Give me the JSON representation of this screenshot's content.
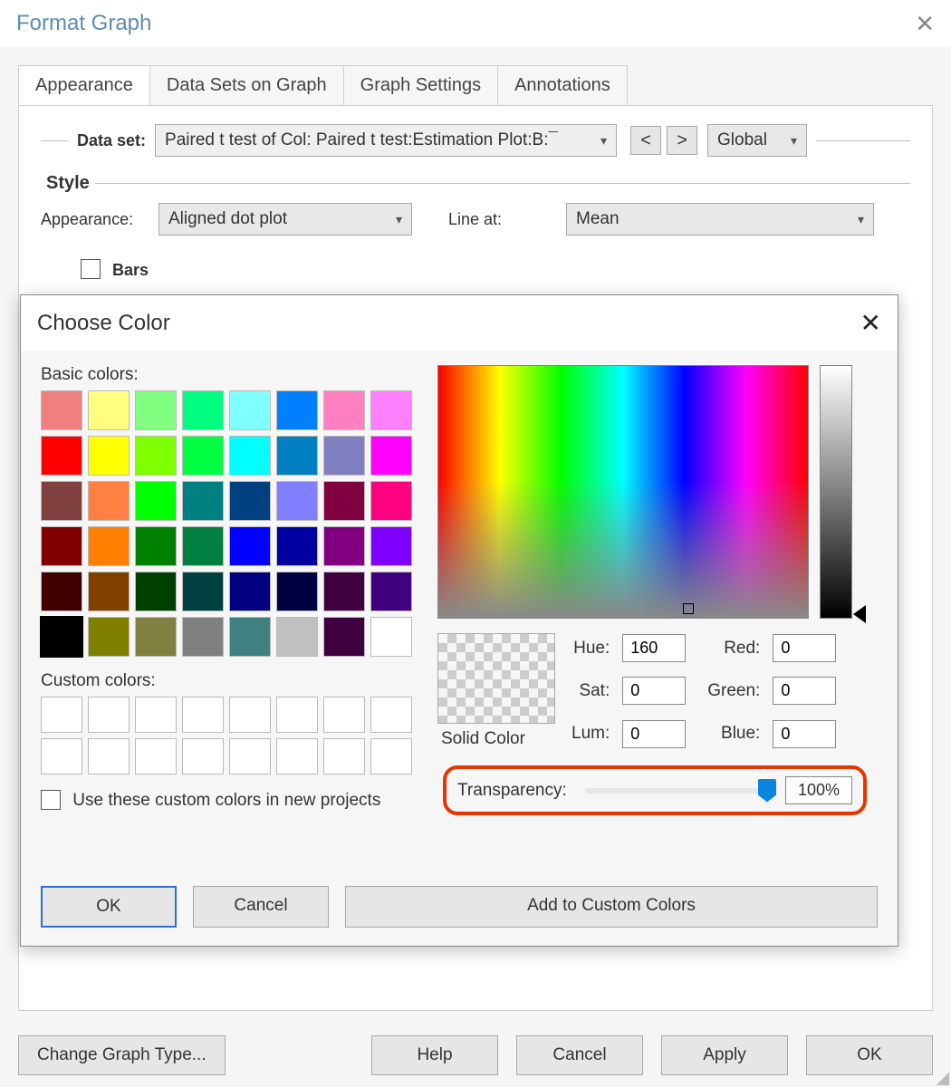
{
  "window": {
    "title": "Format Graph"
  },
  "tabs": {
    "appearance": "Appearance",
    "datasets": "Data Sets on Graph",
    "graph_settings": "Graph Settings",
    "annotations": "Annotations"
  },
  "dataset": {
    "label": "Data set:",
    "value": "Paired t test of Col: Paired t test:Estimation Plot:B:¯",
    "prev": "<",
    "next": ">",
    "scope": "Global"
  },
  "style": {
    "heading": "Style",
    "appearance_label": "Appearance:",
    "appearance_value": "Aligned dot plot",
    "line_at_label": "Line at:",
    "line_at_value": "Mean",
    "bars_label": "Bars"
  },
  "color_dialog": {
    "title": "Choose Color",
    "basic_label": "Basic colors:",
    "custom_label": "Custom colors:",
    "use_in_new": "Use these custom colors in new projects",
    "solid_label": "Solid Color",
    "hue_label": "Hue:",
    "sat_label": "Sat:",
    "lum_label": "Lum:",
    "red_label": "Red:",
    "green_label": "Green:",
    "blue_label": "Blue:",
    "hue": "160",
    "sat": "0",
    "lum": "0",
    "red": "0",
    "green": "0",
    "blue": "0",
    "transparency_label": "Transparency:",
    "transparency_value": "100%",
    "ok": "OK",
    "cancel": "Cancel",
    "add": "Add to Custom Colors",
    "basic_colors": [
      "#f08080",
      "#ffff80",
      "#80ff80",
      "#00ff80",
      "#80ffff",
      "#0080ff",
      "#ff80c0",
      "#ff80ff",
      "#ff0000",
      "#ffff00",
      "#80ff00",
      "#00ff40",
      "#00ffff",
      "#0080c0",
      "#8080c0",
      "#ff00ff",
      "#804040",
      "#ff8040",
      "#00ff00",
      "#008080",
      "#004080",
      "#8080ff",
      "#800040",
      "#ff0080",
      "#800000",
      "#ff8000",
      "#008000",
      "#008040",
      "#0000ff",
      "#0000a0",
      "#800080",
      "#8000ff",
      "#400000",
      "#804000",
      "#004000",
      "#004040",
      "#000080",
      "#000040",
      "#400040",
      "#400080",
      "#000000",
      "#808000",
      "#808040",
      "#808080",
      "#408080",
      "#c0c0c0",
      "#400040",
      "#ffffff"
    ]
  },
  "footer": {
    "change_type": "Change Graph Type...",
    "help": "Help",
    "cancel": "Cancel",
    "apply": "Apply",
    "ok": "OK"
  }
}
